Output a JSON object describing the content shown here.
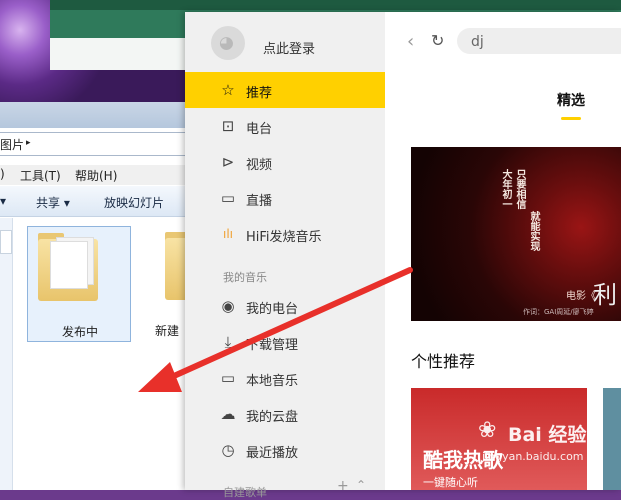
{
  "explorer": {
    "address_fragment": "图片",
    "address_arrow": "▸",
    "menu": [
      "工具(T)",
      "帮助(H)"
    ],
    "toolbar": [
      "共享 ▾",
      "放映幻灯片"
    ],
    "folders": [
      "发布中",
      "新建"
    ]
  },
  "app": {
    "login_label": "点此登录",
    "nav_main": [
      {
        "icon": "☆",
        "icon_name": "star-icon",
        "label": "推荐",
        "active": true
      },
      {
        "icon": "📻",
        "icon_name": "radio-icon",
        "label": "电台"
      },
      {
        "icon": "▶",
        "icon_name": "video-icon",
        "label": "视频"
      },
      {
        "icon": "⎚",
        "icon_name": "camera-icon",
        "label": "直播"
      },
      {
        "icon": "ılı",
        "icon_name": "hifi-icon",
        "label": "HiFi发烧音乐"
      }
    ],
    "section_my_music": "我的音乐",
    "nav_my": [
      {
        "icon": "◉",
        "icon_name": "my-radio-icon",
        "label": "我的电台"
      },
      {
        "icon": "⤓",
        "icon_name": "download-icon",
        "label": "下载管理"
      },
      {
        "icon": "▭",
        "icon_name": "local-music-icon",
        "label": "本地音乐"
      },
      {
        "icon": "☁",
        "icon_name": "cloud-icon",
        "label": "我的云盘"
      },
      {
        "icon": "◷",
        "icon_name": "history-icon",
        "label": "最近播放"
      }
    ],
    "section_playlists": "自建歌单",
    "search_value": "dj",
    "tab_featured": "精选",
    "banner": {
      "col1": "大年初一",
      "col2": "只要相信",
      "col3": "就能实现",
      "movie": "电影《",
      "credits": "作词：GAI周延/廖飞婷",
      "glyph": "利"
    },
    "section_title": "个性推荐",
    "card1_title": "酷我热歌",
    "card1_sub": "一键随心听"
  },
  "watermark": {
    "brand": "Bai 经验",
    "url": "jingyan.baidu.com"
  },
  "colors": {
    "accent": "#ffd000",
    "arrow": "#e8302a"
  }
}
